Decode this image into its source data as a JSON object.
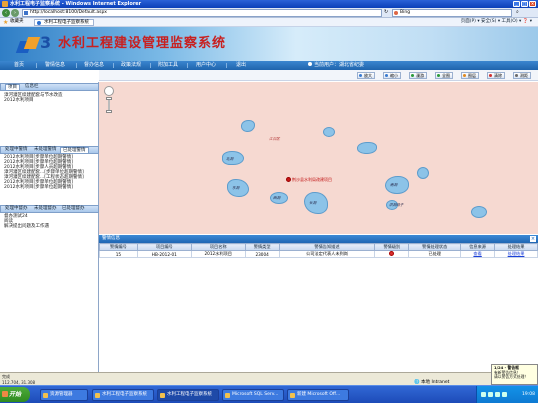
{
  "browser": {
    "window_title": "水利工程电子监察系统 - Windows Internet Explorer",
    "address": "http://localhost:8100/Default.aspx",
    "search_engine": "Bing",
    "favorites_label": "收藏夹",
    "tab_title": "水利工程电子监察系统",
    "toolbar_tools": "页面(P) ▾  安全(S) ▾  工具(O) ▾  ❓ ▾"
  },
  "banner": {
    "title": "水利工程建设管理监察系统"
  },
  "menu": {
    "items": [
      "首页",
      "警情信息",
      "督办信息",
      "政策法规",
      "附加工具",
      "用户中心",
      "退出"
    ],
    "current_user": "当前用户：湖北省纪委"
  },
  "map_toolbar": {
    "buttons": [
      "放大",
      "缩小",
      "漫游",
      "全图",
      "图层",
      "清除",
      "测距"
    ]
  },
  "left_panel": {
    "section1_tabs": [
      "项目",
      "信息栏"
    ],
    "section1_items": [
      "漳河灌区续建配套与节水改造",
      "2012水利项目"
    ],
    "section2_tabs": [
      "处理中警情",
      "未处理警情",
      "已处理警情"
    ],
    "section2_items": [
      "2012水利项目[步骤单位超期警情]",
      "2012水利项目[步骤单位超期警情]",
      "2012水利项目[步骤人员超期警情]",
      "漳河灌区续建配套...[步骤单位超期警情]",
      "漳河灌区续建配套...[工程状态超期警情]",
      "2012水利项目[步骤单位超期警情]",
      "2012水利项目[步骤单位超期警情]"
    ],
    "section3_tabs": [
      "处理中督办",
      "未处理督办",
      "已处理督办"
    ],
    "section3_items": [
      "督办测试24",
      "阅读",
      "解决提出问题及工作遇"
    ]
  },
  "map": {
    "marker_label": "荆沙县水利局改建项目",
    "labels": [
      "江汉区",
      "北湖",
      "东湖",
      "西湖",
      "长湖",
      "南湖",
      "洪湖湾子"
    ]
  },
  "grid": {
    "title": "警情信息",
    "headers": [
      "警情编号",
      "项目编号",
      "项目名称",
      "警情类型",
      "警情告知描述",
      "警情级别",
      "警情处理状态",
      "信息来源",
      "处理结果"
    ],
    "rows": [
      {
        "id": "15",
        "project_no": "HB-2012-01",
        "project_name": "2012水利项目",
        "type": "23004",
        "desc": "公司法定代表人未到岗",
        "state": "已处理",
        "source": "查看",
        "result": "处理结果"
      }
    ]
  },
  "status": {
    "done": "完成",
    "coords": "112.704, 31.308",
    "zone": "本地 Intranet",
    "zoom": "100%"
  },
  "notification": {
    "title": "1/24 - 警告框",
    "lines": [
      "有新警告信息！",
      "请以警告方式处理！"
    ]
  },
  "taskbar": {
    "start": "开始",
    "tasks": [
      "资源管理器",
      "水利工程电子监察系统",
      "水利工程电子监察系统",
      "Microsoft SQL Serv...",
      "新建 Microsoft Off..."
    ],
    "clock": "19:08"
  },
  "colors": {
    "accent": "#1f66b3",
    "title_red": "#c82020",
    "map_bg": "#f6d9d1",
    "lake": "#8cc3e8"
  }
}
